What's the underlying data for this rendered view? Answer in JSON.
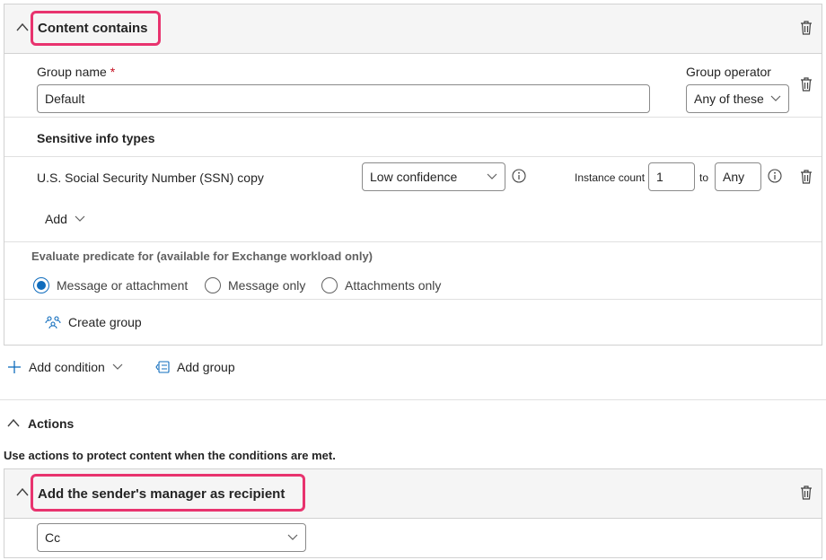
{
  "conditions": {
    "header_title": "Content contains",
    "group_name_label": "Group name",
    "required_mark": "*",
    "group_name_value": "Default",
    "group_operator_label": "Group operator",
    "group_operator_value": "Any of these",
    "sensitive_info_heading": "Sensitive info types",
    "info_type": {
      "name": "U.S. Social Security Number (SSN) copy",
      "confidence": "Low confidence",
      "instance_count_label": "Instance count",
      "instance_min": "1",
      "to_label": "to",
      "instance_max": "Any"
    },
    "add_label": "Add",
    "evaluate_label": "Evaluate predicate for (available for Exchange workload only)",
    "radio_options": [
      {
        "label": "Message or attachment",
        "selected": true
      },
      {
        "label": "Message only",
        "selected": false
      },
      {
        "label": "Attachments only",
        "selected": false
      }
    ],
    "create_group_label": "Create group"
  },
  "toolbar": {
    "add_condition_label": "Add condition",
    "add_group_label": "Add group"
  },
  "actions": {
    "section_title": "Actions",
    "description": "Use actions to protect content when the conditions are met.",
    "header_title": "Add the sender's manager as recipient",
    "recipient_type_value": "Cc"
  },
  "colors": {
    "highlight": "#e8336e",
    "accent": "#0f6cbd",
    "header_bg": "#f5f5f5",
    "border": "#d1d1d1"
  },
  "icons": {
    "collapse": "chevron-up-icon",
    "delete": "trash-icon",
    "dropdown": "chevron-down-icon",
    "info": "info-icon",
    "add": "plus-icon",
    "add_group": "add-group-icon",
    "create_group": "people-group-icon"
  }
}
